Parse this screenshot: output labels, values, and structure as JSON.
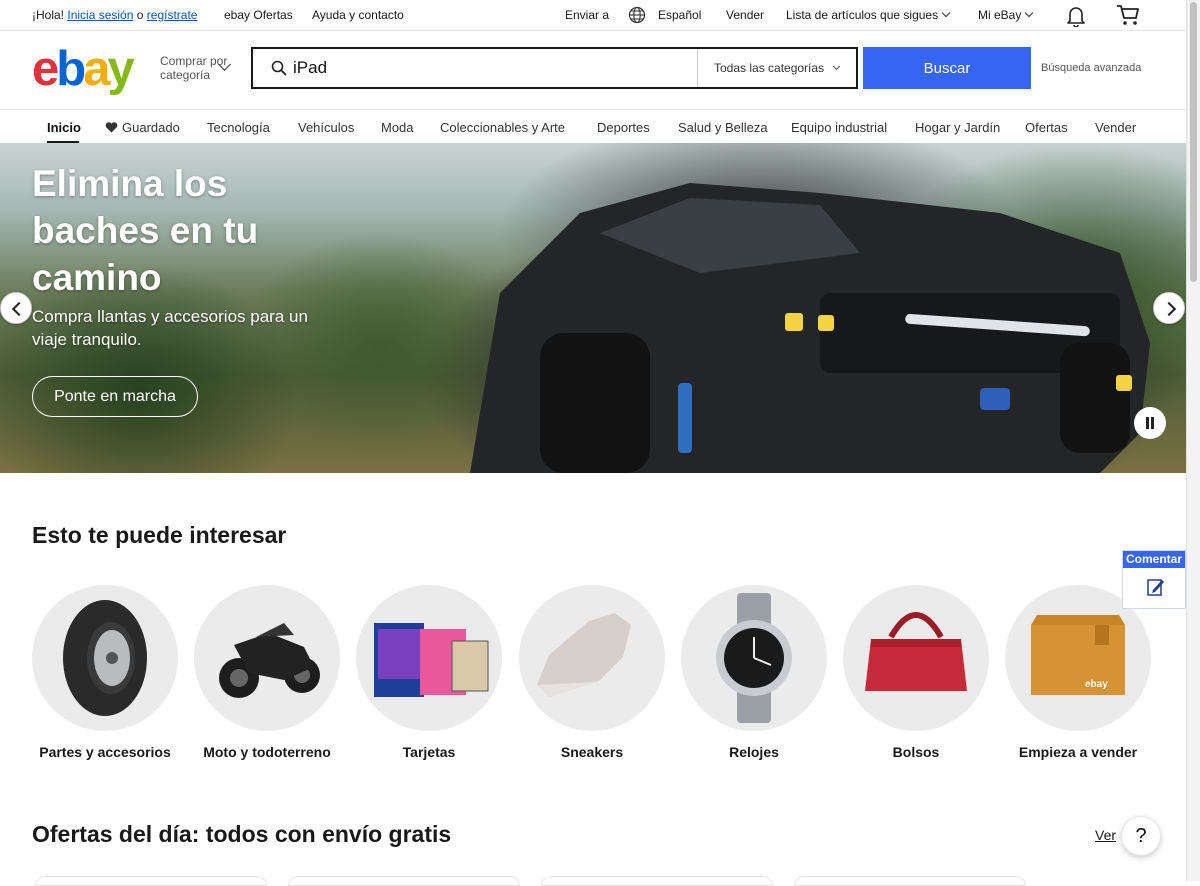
{
  "topbar": {
    "greeting": "¡Hola!",
    "signin": "Inicia sesión",
    "or": "o",
    "register": "regístrate",
    "deals": "ebay Ofertas",
    "help": "Ayuda y contacto",
    "ship_to": "Enviar a",
    "language": "Español",
    "sell": "Vender",
    "watchlist": "Lista de artículos que sigues",
    "my_ebay": "Mi eBay"
  },
  "header": {
    "logo": "ebay",
    "shop_by_category": "Comprar por categoría",
    "search_value": "iPad",
    "category_select": "Todas las categorías",
    "search_button": "Buscar",
    "advanced": "Búsqueda avanzada"
  },
  "nav": {
    "items": [
      "Inicio",
      "Guardado",
      "Tecnología",
      "Vehículos",
      "Moda",
      "Coleccionables y Arte",
      "Deportes",
      "Salud y Belleza",
      "Equipo industrial",
      "Hogar y Jardín",
      "Ofertas",
      "Vender"
    ]
  },
  "hero": {
    "title": "Elimina los baches en tu camino",
    "subtitle": "Compra llantas y accesorios para un viaje tranquilo.",
    "cta": "Ponte en marcha"
  },
  "interests": {
    "title": "Esto te puede interesar",
    "categories": [
      "Partes y accesorios",
      "Moto y todoterreno",
      "Tarjetas",
      "Sneakers",
      "Relojes",
      "Bolsos",
      "Empieza a vender"
    ],
    "box_brand": "ebay"
  },
  "deals": {
    "title": "Ofertas del día: todos con envío gratis",
    "see_all": "Ver"
  },
  "feedback": {
    "label": "Comentar"
  },
  "help_label": "?",
  "colors": {
    "accent": "#3665f3",
    "logo_e": "#e53238",
    "logo_b": "#0064d2",
    "logo_a": "#f5af02",
    "logo_y": "#86b817"
  }
}
